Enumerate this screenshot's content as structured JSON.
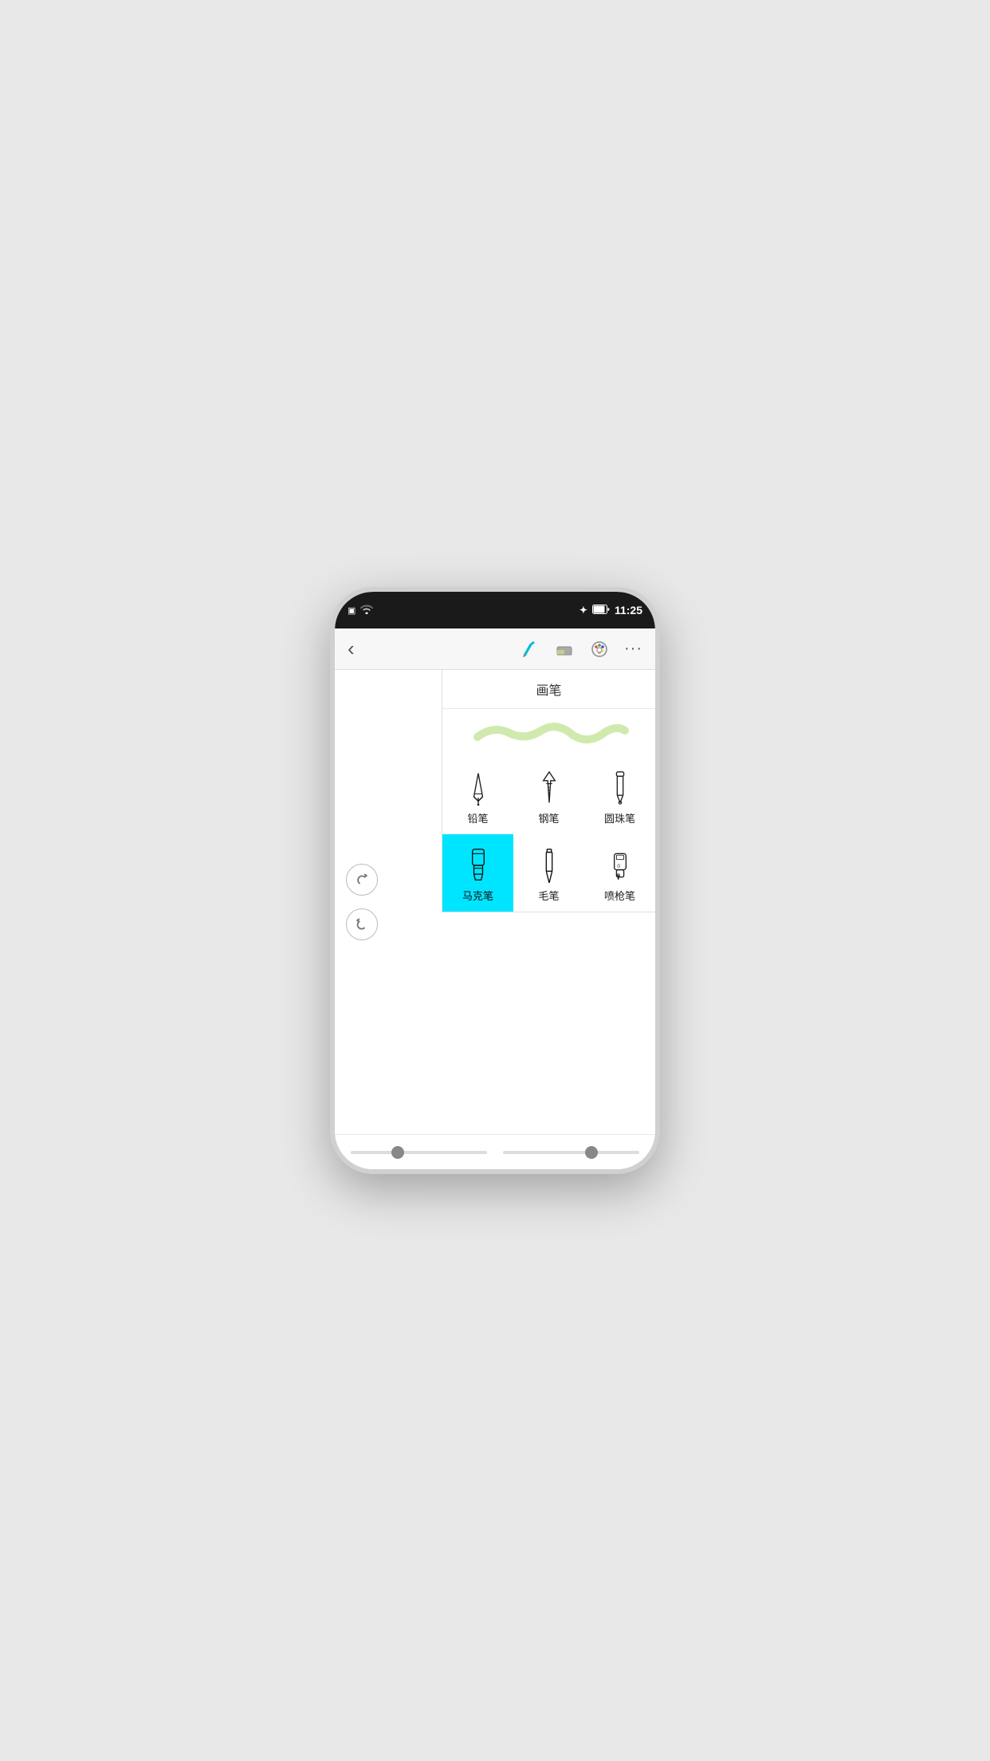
{
  "statusBar": {
    "time": "11:25",
    "batteryIcon": "🔋",
    "bluetoothIcon": "✦"
  },
  "toolbar": {
    "backLabel": "‹",
    "moreLabel": "···"
  },
  "brushPanel": {
    "title": "画笔",
    "brushes": [
      {
        "id": "pencil",
        "label": "铅笔",
        "active": false
      },
      {
        "id": "pen",
        "label": "钢笔",
        "active": false
      },
      {
        "id": "ballpen",
        "label": "圆珠笔",
        "active": false
      },
      {
        "id": "marker",
        "label": "马克笔",
        "active": true
      },
      {
        "id": "brush",
        "label": "毛笔",
        "active": false
      },
      {
        "id": "spray",
        "label": "喷枪笔",
        "active": false
      }
    ]
  },
  "sliders": {
    "left": {
      "value": 30
    },
    "right": {
      "value": 60
    }
  }
}
